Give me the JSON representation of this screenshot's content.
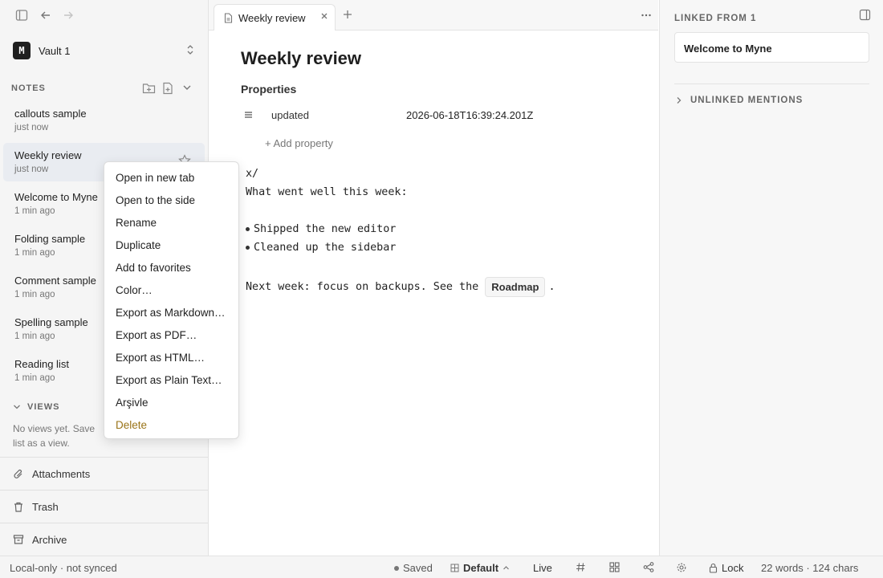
{
  "sidebar": {
    "vault": {
      "badge": "M",
      "name": "Vault 1"
    },
    "notes_heading": "NOTES",
    "notes": [
      {
        "title": "callouts sample",
        "time": "just now"
      },
      {
        "title": "Weekly review",
        "time": "just now"
      },
      {
        "title": "Welcome to Myne",
        "time": "1 min ago"
      },
      {
        "title": "Folding sample",
        "time": "1 min ago"
      },
      {
        "title": "Comment sample",
        "time": "1 min ago"
      },
      {
        "title": "Spelling sample",
        "time": "1 min ago"
      },
      {
        "title": "Reading list",
        "time": "1 min ago"
      }
    ],
    "views_heading": "VIEWS",
    "views_empty": "No views yet. Save list as a view.",
    "links": [
      "Attachments",
      "Trash",
      "Archive"
    ]
  },
  "tab": {
    "label": "Weekly review"
  },
  "editor": {
    "title": "Weekly review",
    "properties_heading": "Properties",
    "property": {
      "key": "updated",
      "value": "2026-06-18T16:39:24.201Z"
    },
    "add_property": "+ Add property",
    "lines": [
      "x/",
      "What went well this week:"
    ],
    "bullets": [
      "Shipped the new editor",
      "Cleaned up the sidebar"
    ],
    "next_week": "Next week: focus on backups. See the",
    "link_label": "Roadmap",
    "next_week_end": "."
  },
  "right_panel": {
    "linked_heading": "LINKED FROM 1",
    "linked_note": "Welcome to Myne",
    "unlinked_heading": "UNLINKED MENTIONS"
  },
  "status": {
    "sync": "Local-only · not synced",
    "saved": "Saved",
    "theme": "Default",
    "mode": "Live",
    "lock": "Lock",
    "counts": "22 words · 124 chars"
  },
  "context_menu": {
    "items": [
      "Open in new tab",
      "Open to the side",
      "Rename",
      "Duplicate",
      "Add to favorites",
      "Color…",
      "Export as Markdown…",
      "Export as PDF…",
      "Export as HTML…",
      "Export as Plain Text…",
      "Arşivle",
      "Delete"
    ]
  },
  "colors": {
    "accent_active": "#e9ecf1",
    "danger": "#9a7418"
  }
}
